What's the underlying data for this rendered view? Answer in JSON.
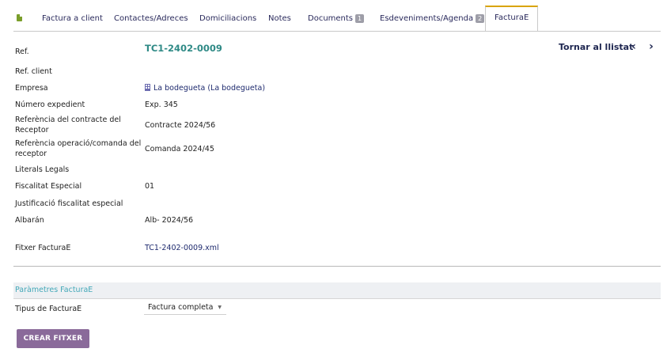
{
  "tabs": [
    {
      "id": "factura_client",
      "label": "Factura a client"
    },
    {
      "id": "contactes",
      "label": "Contactes/Adreces"
    },
    {
      "id": "domiciliacions",
      "label": "Domiciliacions"
    },
    {
      "id": "notes",
      "label": "Notes"
    },
    {
      "id": "documents",
      "label": "Documents",
      "badge": "1"
    },
    {
      "id": "esdeveniments",
      "label": "Esdeveniments/Agenda",
      "badge": "2"
    },
    {
      "id": "facturae",
      "label": "FacturaE",
      "active": true
    }
  ],
  "header": {
    "ref_label": "Ref.",
    "ref_value": "TC1-2402-0009",
    "back_label": "Tornar al llistat",
    "prev_glyph": "‹",
    "next_glyph": "›"
  },
  "fields": {
    "ref_client": {
      "label": "Ref. client",
      "value": ""
    },
    "empresa": {
      "label": "Empresa",
      "value": "La bodegueta (La bodegueta)"
    },
    "num_expedient": {
      "label": "Número expedient",
      "value": "Exp. 345"
    },
    "ref_contracte": {
      "label": "Referència del contracte del Receptor",
      "value": "Contracte 2024/56"
    },
    "ref_operacio": {
      "label": "Referència operació/comanda del receptor",
      "value": "Comanda 2024/45"
    },
    "literals_legals": {
      "label": "Literals Legals",
      "value": ""
    },
    "fiscalitat_especial": {
      "label": "Fiscalitat Especial",
      "value": "01"
    },
    "justificacio_fiscalitat": {
      "label": "Justificació fiscalitat especial",
      "value": ""
    },
    "albaran": {
      "label": "Albarán",
      "value": "Alb- 2024/56"
    },
    "fitxer_facturae": {
      "label": "Fitxer FacturaE",
      "value": "TC1-2402-0009.xml"
    }
  },
  "params": {
    "section_title": "Paràmetres FacturaE",
    "tipus_label": "Tipus de FacturaE",
    "tipus_value": "Factura completa"
  },
  "actions": {
    "create_label": "CREAR FITXER"
  },
  "colors": {
    "accent_tab": "#d9a400",
    "ref_teal": "#2f8a86",
    "button": "#8a6a9a",
    "section_title": "#43a8b8"
  }
}
